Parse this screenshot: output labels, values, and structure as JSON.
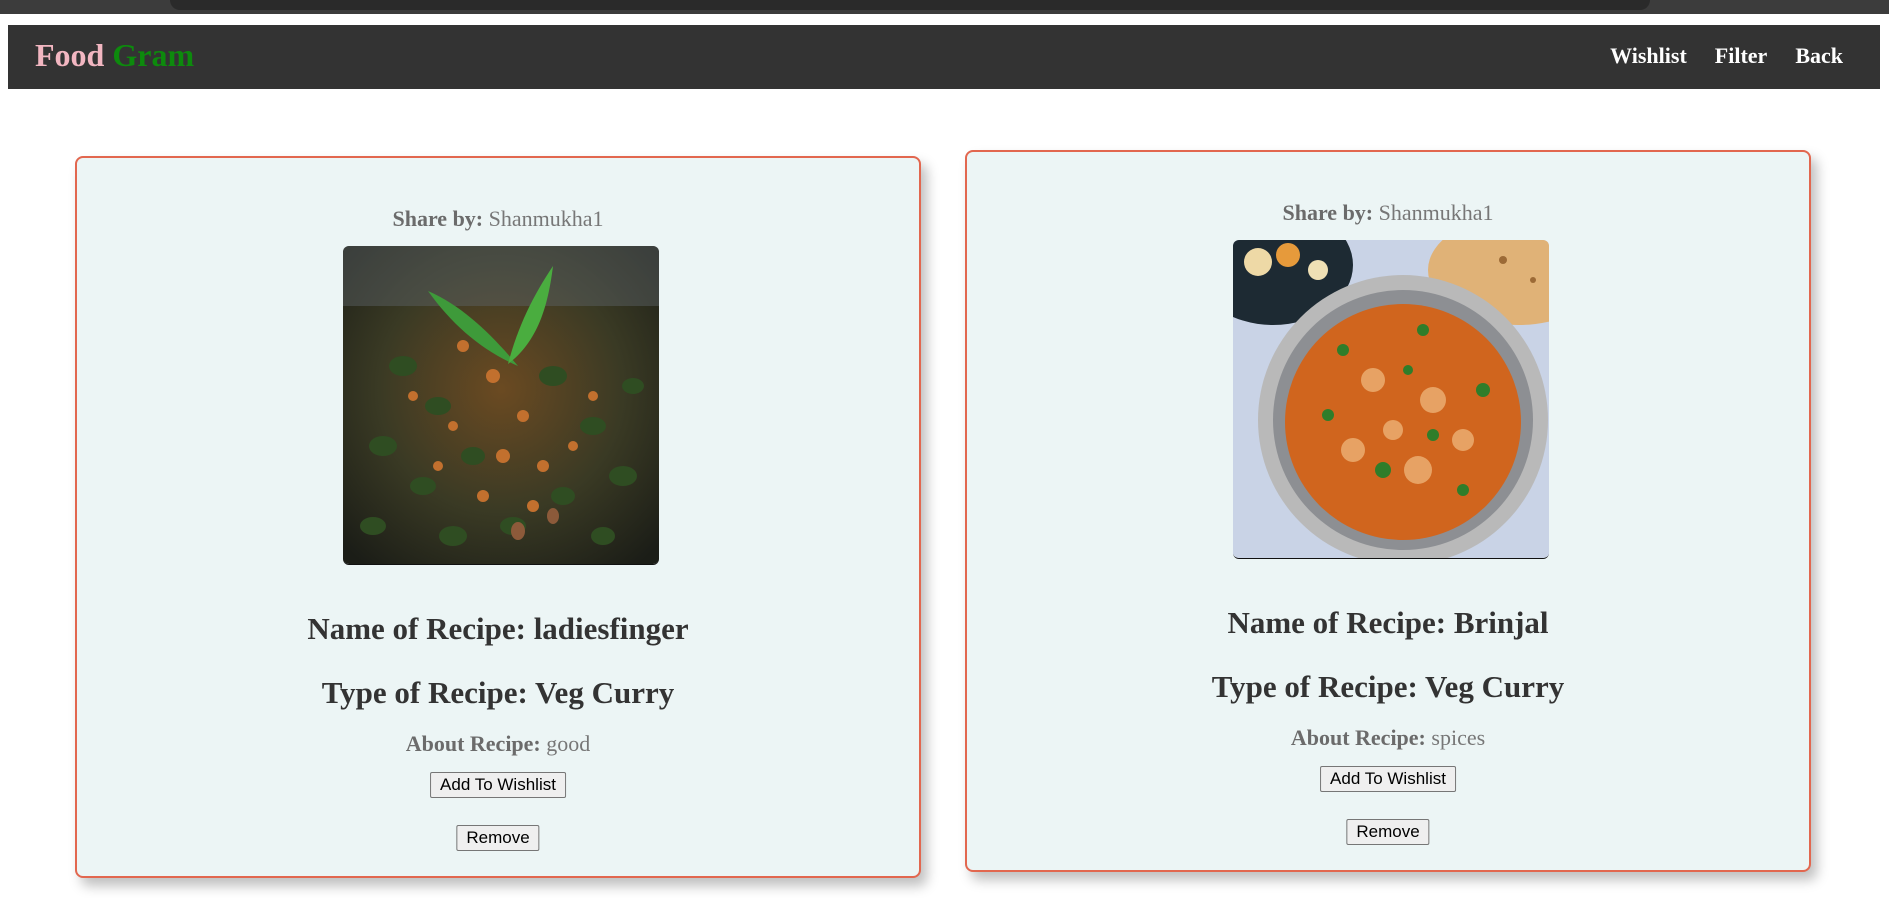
{
  "brand": {
    "part1": "Food",
    "part2": "Gram",
    "part1_color": "#f2b6c1",
    "part2_color": "#0d8a0d"
  },
  "nav": {
    "items": [
      {
        "label": "Wishlist"
      },
      {
        "label": "Filter"
      },
      {
        "label": "Back"
      }
    ]
  },
  "colors": {
    "navbar": "#333333",
    "card_bg": "#ecf5f5",
    "card_border": "#e2674f"
  },
  "cards": [
    {
      "share_label": "Share by:",
      "share_user": "Shanmukha1",
      "image": "okra-fry-photo",
      "name": "Name of Recipe: ladiesfinger",
      "type": "Type of Recipe: Veg Curry",
      "about_label": "About Recipe:",
      "about_value": "good",
      "wishlist_button": "Add To Wishlist",
      "remove_button": "Remove"
    },
    {
      "share_label": "Share by:",
      "share_user": "Shanmukha1",
      "image": "curry-bowl-photo",
      "name": "Name of Recipe: Brinjal",
      "type": "Type of Recipe: Veg Curry",
      "about_label": "About Recipe:",
      "about_value": "spices",
      "wishlist_button": "Add To Wishlist",
      "remove_button": "Remove"
    }
  ]
}
